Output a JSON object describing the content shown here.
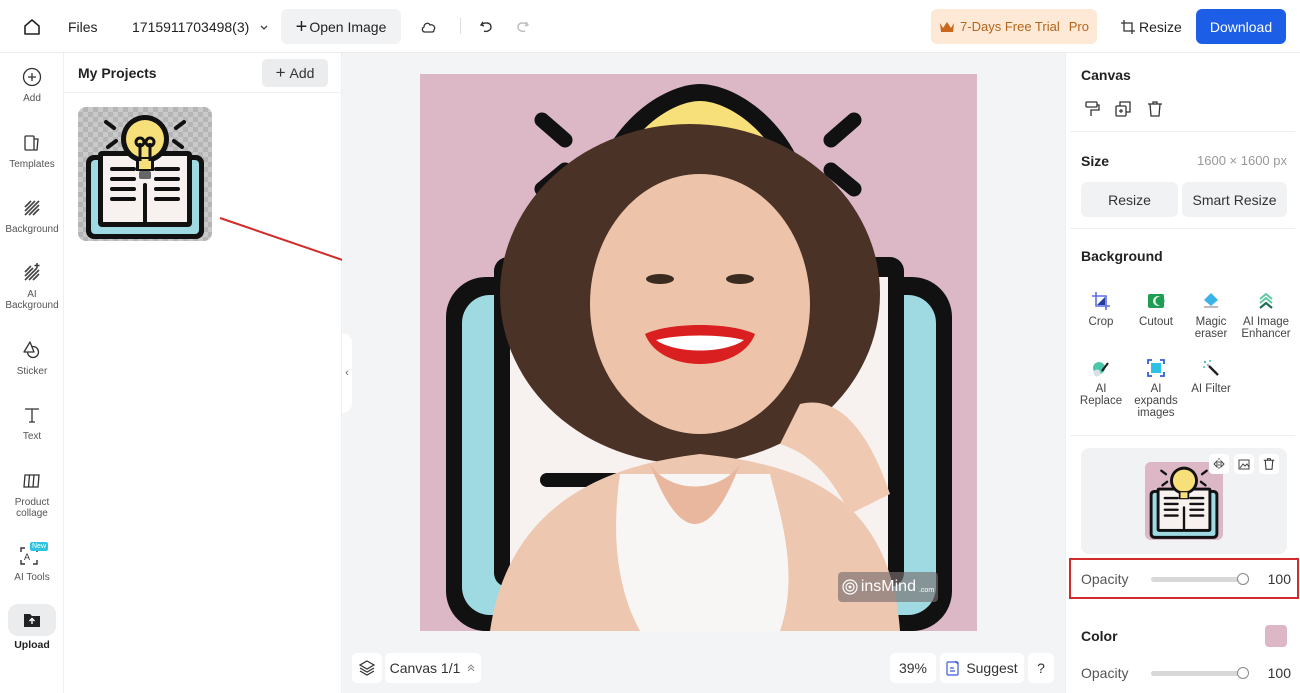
{
  "topbar": {
    "files_label": "Files",
    "filename": "1715911703498(3)",
    "open_image_label": "Open Image",
    "trial_label": "7-Days Free Trial",
    "trial_badge": "Pro",
    "resize_label": "Resize",
    "download_label": "Download",
    "colors": {
      "download_bg": "#1d5ee6",
      "trial_bg": "#fde9d5",
      "trial_text": "#b5651d"
    }
  },
  "leftnav": {
    "items": [
      {
        "label": "Add",
        "icon": "plus-circle-icon"
      },
      {
        "label": "Templates",
        "icon": "templates-icon"
      },
      {
        "label": "Background",
        "icon": "hatch-icon"
      },
      {
        "label": "AI Background",
        "icon": "ai-hatch-icon"
      },
      {
        "label": "Sticker",
        "icon": "sticker-icon"
      },
      {
        "label": "Text",
        "icon": "text-icon"
      },
      {
        "label": "Product collage",
        "icon": "collage-icon"
      },
      {
        "label": "AI Tools",
        "icon": "ai-tools-icon",
        "badge": "New"
      },
      {
        "label": "Upload",
        "icon": "upload-folder-icon",
        "active": true
      }
    ]
  },
  "projects": {
    "title": "My Projects",
    "add_label": "Add",
    "items": [
      {
        "name": "lightbulb-book-sticker"
      }
    ]
  },
  "workspace": {
    "canvas_label": "Canvas 1/1",
    "zoom": "39%",
    "suggest_label": "Suggest",
    "help_label": "?",
    "watermark": "insMind",
    "watermark_suffix": ".com",
    "canvas_bg": "#dcb8c6"
  },
  "rightpanel": {
    "canvas_title": "Canvas",
    "size_label": "Size",
    "size_value": "1600 × 1600 px",
    "resize_label": "Resize",
    "smart_resize_label": "Smart Resize",
    "background_title": "Background",
    "tools": [
      {
        "label": "Crop",
        "icon": "crop-icon"
      },
      {
        "label": "Cutout",
        "icon": "cutout-icon"
      },
      {
        "label": "Magic eraser",
        "icon": "magic-eraser-icon"
      },
      {
        "label": "AI Image Enhancer",
        "icon": "enhancer-icon"
      },
      {
        "label": "AI Replace",
        "icon": "ai-replace-icon"
      },
      {
        "label": "AI expands images",
        "icon": "ai-expand-icon"
      },
      {
        "label": "AI Filter",
        "icon": "ai-filter-icon"
      }
    ],
    "layer_opacity_label": "Opacity",
    "layer_opacity_value": "100",
    "layer_opacity_fraction": 1.0,
    "color_title": "Color",
    "color_value": "#dcb8c6",
    "color_opacity_label": "Opacity",
    "color_opacity_value": "100",
    "color_opacity_fraction": 1.0
  }
}
